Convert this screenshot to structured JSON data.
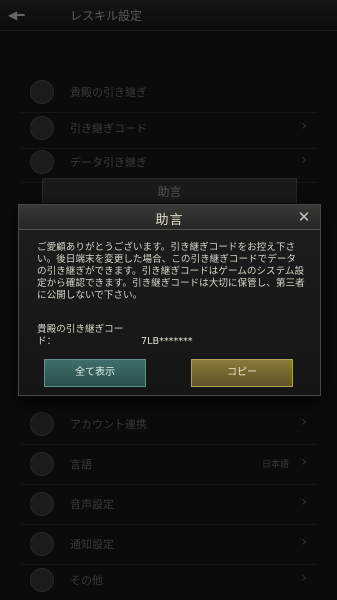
{
  "background": {
    "title": "レスキル設定",
    "description": "",
    "header_band": "助言",
    "rows": [
      {
        "label": "貴殿の引き継ぎ",
        "value": ""
      },
      {
        "label": "引き継ぎコード",
        "value": ""
      },
      {
        "label": "データ引き継ぎ",
        "value": ""
      },
      {
        "label": "アカウント連携",
        "value": ""
      },
      {
        "label": "言語",
        "value": "日本語"
      },
      {
        "label": "音声設定",
        "value": ""
      },
      {
        "label": "通知設定",
        "value": ""
      },
      {
        "label": "その他",
        "value": ""
      }
    ]
  },
  "dialog": {
    "title": "助言",
    "message": "ご愛顧ありがとうございます。引き継ぎコードをお控え下さい。後日端末を変更した場合、この引き継ぎコードでデータの引き継ぎができます。引き継ぎコードはゲームのシステム設定から確認できます。引き継ぎコードは大切に保管し、第三者に公開しないで下さい。",
    "code_label": "貴殿の引き継ぎコード：",
    "code_value": "7LB*******",
    "show_all_label": "全て表示",
    "copy_label": "コピー"
  },
  "colors": {
    "show_button": "#2f5956",
    "copy_button": "#76683a",
    "dialog_border": "#4a4540"
  }
}
